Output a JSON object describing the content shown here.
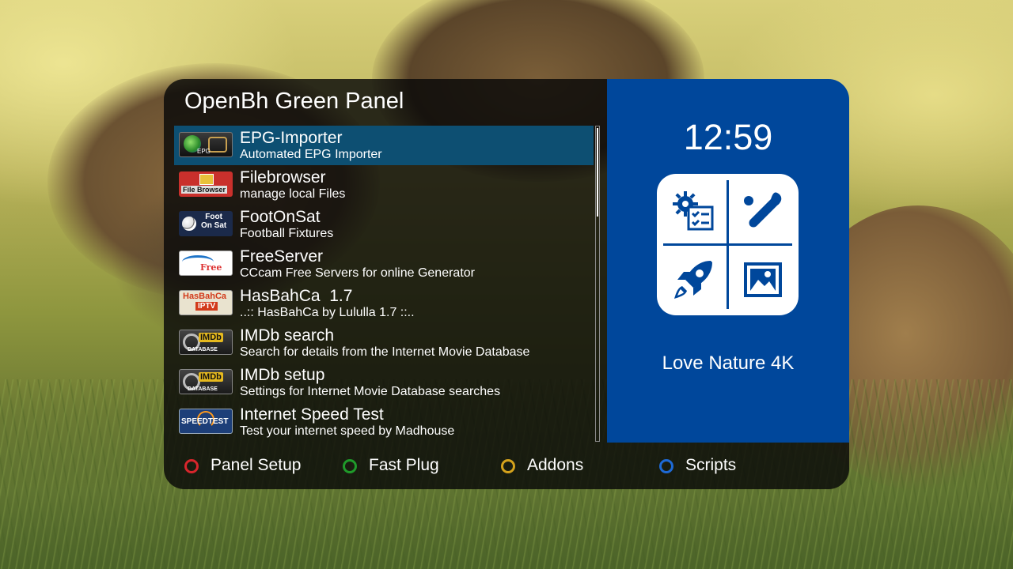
{
  "panel": {
    "title": "OpenBh Green Panel"
  },
  "plugins": [
    {
      "title": "EPG-Importer",
      "description": "Automated EPG Importer",
      "icon": "epg-importer-icon",
      "icon_text": "EPG",
      "selected": true
    },
    {
      "title": "Filebrowser",
      "description": "manage local Files",
      "icon": "filebrowser-icon",
      "icon_text": "File Browser"
    },
    {
      "title": "FootOnSat",
      "description": "Football Fixtures",
      "icon": "footonsat-icon",
      "icon_text_1": "Foot",
      "icon_text_2": "On Sat"
    },
    {
      "title": "FreeServer",
      "description": "CCcam Free Servers for online Generator",
      "icon": "freeserver-icon",
      "icon_text": "Free"
    },
    {
      "title": "HasBahCa  1.7",
      "description": "..:: HasBahCa by Lululla 1.7 ::..",
      "icon": "hasbahca-icon",
      "icon_text_1": "HasBahCa",
      "icon_text_2": "IPTV"
    },
    {
      "title": "IMDb search",
      "description": "Search for details from the Internet Movie Database",
      "icon": "imdb-icon",
      "icon_text_1": "IMDb",
      "icon_text_2": "DATABASE"
    },
    {
      "title": "IMDb setup",
      "description": "Settings for Internet Movie Database searches",
      "icon": "imdb-icon",
      "icon_text_1": "IMDb",
      "icon_text_2": "DATABASE"
    },
    {
      "title": "Internet Speed Test",
      "description": "Test your internet speed by Madhouse",
      "icon": "speedtest-icon",
      "icon_text": "SPEEDTEST"
    }
  ],
  "info": {
    "clock": "12:59",
    "channel": "Love Nature 4K",
    "quadrant_icons": [
      "settings-checklist-icon",
      "sports-bat-ball-icon",
      "rocket-icon",
      "picture-icon"
    ]
  },
  "footer": {
    "buttons": [
      {
        "label": "Panel Setup",
        "color": "#d8262c"
      },
      {
        "label": "Fast Plug",
        "color": "#1f9a2a"
      },
      {
        "label": "Addons",
        "color": "#d4a21c"
      },
      {
        "label": "Scripts",
        "color": "#1e6ad6"
      }
    ]
  },
  "colors": {
    "selection": "#0d4f72",
    "info_panel": "#00479b"
  }
}
